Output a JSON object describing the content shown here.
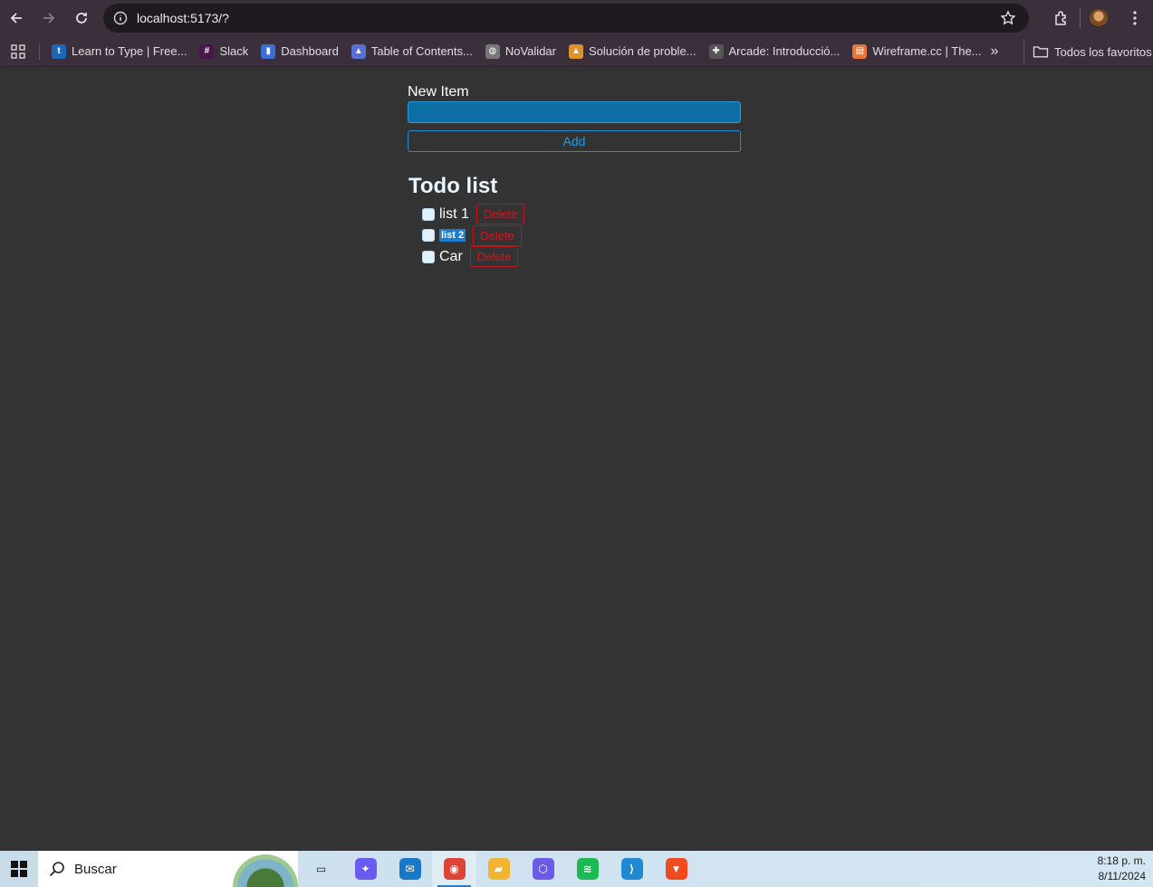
{
  "browser": {
    "url": "localhost:5173/?",
    "bookmarks": [
      {
        "label": "Learn to Type | Free...",
        "icon": "typing-site-icon",
        "color": "#1a66b8",
        "glyph": "t"
      },
      {
        "label": "Slack",
        "icon": "slack-icon",
        "color": "#4a154b",
        "glyph": "#"
      },
      {
        "label": "Dashboard",
        "icon": "dashboard-chart-icon",
        "color": "#3b6fd6",
        "glyph": "▮"
      },
      {
        "label": "Table of Contents...",
        "icon": "triangle-logo-icon",
        "color": "#5a6fd6",
        "glyph": "▲"
      },
      {
        "label": "NoValidar",
        "icon": "globe-icon",
        "color": "#777777",
        "glyph": "◍"
      },
      {
        "label": "Solución de proble...",
        "icon": "triangle-logo-icon",
        "color": "#e0922a",
        "glyph": "▲"
      },
      {
        "label": "Arcade: Introducció...",
        "icon": "arcade-icon",
        "color": "#555555",
        "glyph": "✚"
      },
      {
        "label": "Wireframe.cc | The...",
        "icon": "wireframe-icon",
        "color": "#e8743a",
        "glyph": "▤"
      }
    ],
    "all_favorites": "Todos los favoritos"
  },
  "app": {
    "new_item_label": "New Item",
    "new_item_value": "",
    "add_label": "Add",
    "list_title": "Todo list",
    "todos": [
      {
        "label": "list 1",
        "checked": false,
        "delete_label": "Delete",
        "selected": false
      },
      {
        "label": "list 2",
        "checked": false,
        "delete_label": "Delete",
        "selected": true
      },
      {
        "label": "Car",
        "checked": false,
        "delete_label": "Delete",
        "selected": false
      }
    ]
  },
  "taskbar": {
    "search_placeholder": "Buscar",
    "time": "8:18 p. m.",
    "date": "8/11/2024",
    "apps": [
      {
        "name": "task-view-icon",
        "color": "transparent",
        "glyph": "▭"
      },
      {
        "name": "copilot-icon",
        "color": "#6a5cf0",
        "glyph": "✦"
      },
      {
        "name": "mail-icon",
        "color": "#1a78c8",
        "glyph": "✉"
      },
      {
        "name": "chrome-icon",
        "color": "#db4437",
        "glyph": "◉"
      },
      {
        "name": "file-explorer-icon",
        "color": "#f2b431",
        "glyph": "▰"
      },
      {
        "name": "office-icon",
        "color": "#6b5be8",
        "glyph": "⬡"
      },
      {
        "name": "spotify-icon",
        "color": "#1db954",
        "glyph": "≋"
      },
      {
        "name": "vscode-icon",
        "color": "#1f8ad2",
        "glyph": "⟩"
      },
      {
        "name": "brave-icon",
        "color": "#f04a1e",
        "glyph": "▼"
      }
    ]
  }
}
